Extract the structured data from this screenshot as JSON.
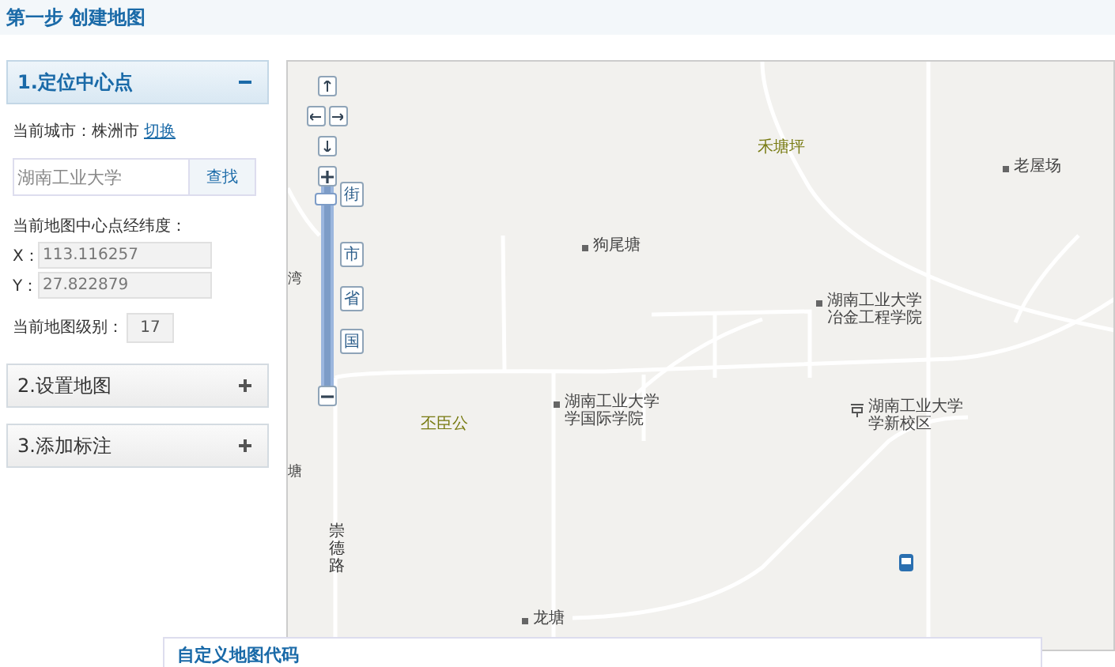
{
  "header": {
    "title": "第一步 创建地图"
  },
  "panels": [
    {
      "title": "1.定位中心点",
      "expanded": true
    },
    {
      "title": "2.设置地图",
      "expanded": false
    },
    {
      "title": "3.添加标注",
      "expanded": false
    }
  ],
  "locate": {
    "city_label": "当前城市：",
    "city": "株洲市",
    "switch_link": "切换",
    "search": {
      "value": "湖南工业大学",
      "button": "查找"
    },
    "center_label": "当前地图中心点经纬度：",
    "x_label": "X：",
    "x_value": "113.116257",
    "y_label": "Y：",
    "y_value": "27.822879",
    "zoom_label": "当前地图级别：",
    "zoom_value": "17"
  },
  "map": {
    "scale_labels": [
      "街",
      "市",
      "省",
      "国"
    ],
    "zoom_slider": {
      "level": 0.97
    },
    "places": [
      {
        "kind": "area",
        "lines": [
          "禾塘坪"
        ]
      },
      {
        "kind": "poi",
        "lines": [
          "老屋场"
        ]
      },
      {
        "kind": "poi",
        "lines": [
          "狗尾塘"
        ]
      },
      {
        "kind": "poi",
        "lines": [
          "湖南工业大学",
          "冶金工程学院"
        ]
      },
      {
        "kind": "area",
        "lines": [
          "丕臣公"
        ]
      },
      {
        "kind": "poi",
        "lines": [
          "湖南工业大学",
          "学国际学院"
        ]
      },
      {
        "kind": "school",
        "lines": [
          "湖南工业大学",
          "学新校区"
        ]
      },
      {
        "kind": "road",
        "lines": [
          "崇德路"
        ]
      },
      {
        "kind": "poi",
        "lines": [
          "龙塘"
        ]
      },
      {
        "kind": "edge",
        "lines": [
          "湾"
        ]
      },
      {
        "kind": "edge",
        "lines": [
          "塘"
        ]
      },
      {
        "kind": "bus"
      }
    ]
  },
  "code_panel": {
    "title": "自定义地图代码"
  }
}
